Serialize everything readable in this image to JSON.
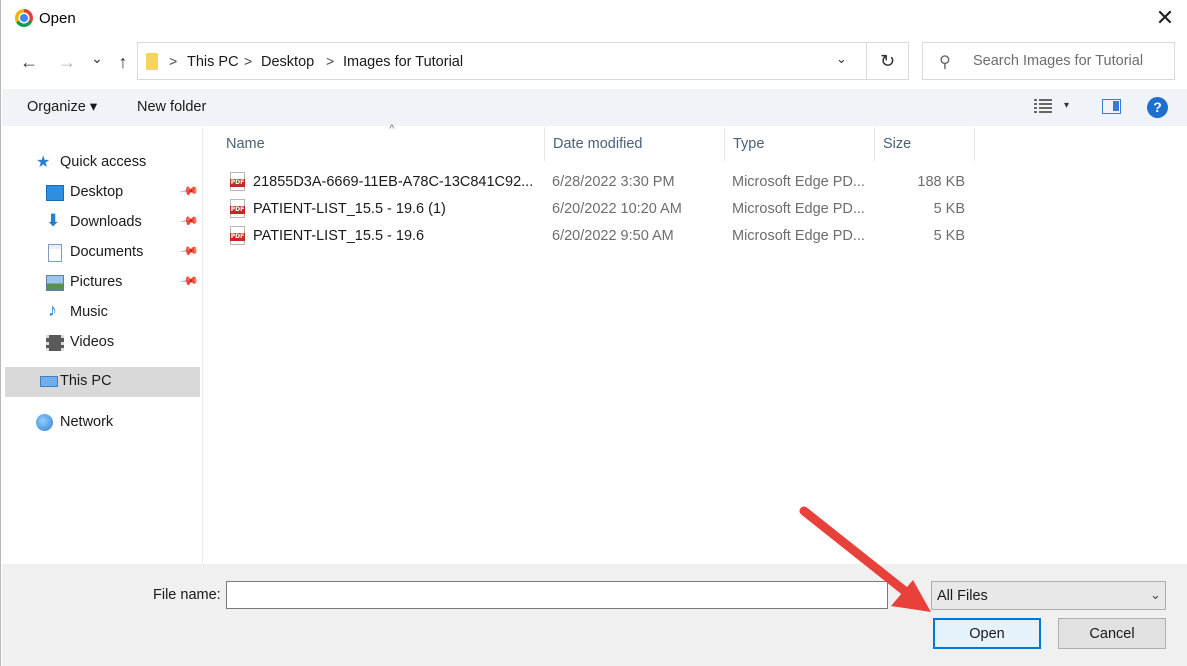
{
  "window": {
    "title": "Open",
    "close_glyph": "✕"
  },
  "nav": {
    "back_glyph": "←",
    "forward_glyph": "→",
    "recent_glyph": "⌄",
    "up_glyph": "↑"
  },
  "address": {
    "breadcrumbs": [
      "This PC",
      "Desktop",
      "Images for Tutorial"
    ],
    "separator": ">",
    "dropdown_glyph": "⌄",
    "refresh_glyph": "↻"
  },
  "search": {
    "placeholder": "Search Images for Tutorial",
    "icon_glyph": "⚲"
  },
  "commandbar": {
    "organize": "Organize ▾",
    "new_folder": "New folder",
    "view_dropdown_glyph": "▾",
    "help_glyph": "?"
  },
  "sidebar": {
    "items": [
      {
        "label": "Quick access",
        "icon": "star-icon"
      },
      {
        "label": "Desktop",
        "icon": "desktop-folder-icon",
        "pinned": true
      },
      {
        "label": "Downloads",
        "icon": "download-arrow-icon",
        "pinned": true
      },
      {
        "label": "Documents",
        "icon": "document-icon",
        "pinned": true
      },
      {
        "label": "Pictures",
        "icon": "pictures-icon",
        "pinned": true
      },
      {
        "label": "Music",
        "icon": "music-note-icon"
      },
      {
        "label": "Videos",
        "icon": "film-icon"
      },
      {
        "label": "This PC",
        "icon": "computer-icon",
        "selected": true
      },
      {
        "label": "Network",
        "icon": "network-icon"
      }
    ],
    "pin_glyph": "📌"
  },
  "filelist": {
    "columns": [
      "Name",
      "Date modified",
      "Type",
      "Size"
    ],
    "sort_glyph": "^",
    "rows": [
      {
        "name": "21855D3A-6669-11EB-A78C-13C841C92...",
        "date": "6/28/2022 3:30 PM",
        "type": "Microsoft Edge PD...",
        "size": "188 KB"
      },
      {
        "name": "PATIENT-LIST_15.5 - 19.6 (1)",
        "date": "6/20/2022 10:20 AM",
        "type": "Microsoft Edge PD...",
        "size": "5 KB"
      },
      {
        "name": "PATIENT-LIST_15.5 - 19.6",
        "date": "6/20/2022 9:50 AM",
        "type": "Microsoft Edge PD...",
        "size": "5 KB"
      }
    ]
  },
  "footer": {
    "file_name_label": "File name:",
    "file_name_value": "",
    "filter_value": "All Files",
    "filter_chevron": "⌄",
    "open_label": "Open",
    "cancel_label": "Cancel"
  },
  "colors": {
    "accent": "#0078d7",
    "annotation_arrow": "#e8413c",
    "selection": "#d9d9d9"
  }
}
